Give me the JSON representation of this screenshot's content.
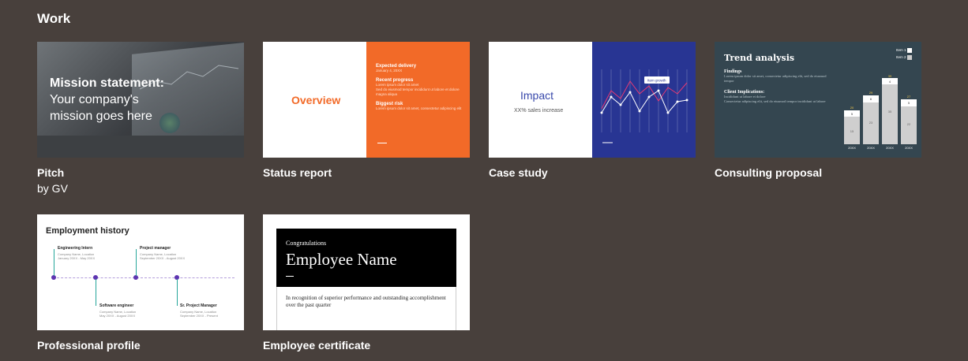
{
  "section": {
    "title": "Work"
  },
  "templates": [
    {
      "name": "Pitch",
      "author": "by GV",
      "thumb": {
        "line1": "Mission statement:",
        "line2": "Your company's",
        "line3": "mission goes here"
      }
    },
    {
      "name": "Status report",
      "thumb": {
        "title": "Overview",
        "h1": "Expected delivery",
        "d1": "January 4, 20XX",
        "h2": "Recent progress",
        "b1": "Lorem ipsum dolor sit amet",
        "b2": "Sed do eiusmod tempor incididunt ut labore et dolore magna aliqua",
        "h3": "Biggest risk",
        "r1": "Lorem ipsum dolor sit amet, consectetur adipiscing elit"
      }
    },
    {
      "name": "Case study",
      "thumb": {
        "title": "Impact",
        "sub": "XX% sales increase",
        "callout": "Item growth"
      }
    },
    {
      "name": "Consulting proposal",
      "thumb": {
        "title": "Trend analysis",
        "h1": "Findings",
        "t1": "Lorem ipsum dolor sit amet, consectetur adipiscing elit, sed do eiusmod tempor",
        "h2": "Client Implications:",
        "b1": "Incididunt ut labore et dolore",
        "b2": "Consectetur adipiscing elit, sed do eiusmod tempor incididunt ut labore",
        "legend1": "Item 1",
        "legend2": "Item 2",
        "bars": [
          {
            "top": "20",
            "mid": "5",
            "low": "15",
            "x": "20XX"
          },
          {
            "top": "29",
            "mid": "6",
            "low": "23",
            "x": "20XX"
          },
          {
            "top": "39",
            "mid": "4",
            "low": "35",
            "x": "20XX"
          },
          {
            "top": "27",
            "mid": "5",
            "low": "22",
            "x": "20XX"
          }
        ]
      }
    },
    {
      "name": "Professional profile",
      "thumb": {
        "title": "Employment history",
        "j1": "Engineering Intern",
        "j1c": "Company Name, Location",
        "j1d": "January 20XX - May 20XX",
        "j2": "Project manager",
        "j2c": "Company Name, Location",
        "j2d": "September 20XX - August 20XX",
        "j3": "Software engineer",
        "j3c": "Company Name, Location",
        "j3d": "May 20XX - August 20XX",
        "j4": "Sr. Project Manager",
        "j4c": "Company Name, Location",
        "j4d": "September 20XX - Present"
      }
    },
    {
      "name": "Employee certificate",
      "thumb": {
        "congrats": "Congratulations",
        "employee": "Employee Name",
        "desc": "In recognition of superior performance and outstanding accomplishment over the past quarter"
      }
    }
  ]
}
